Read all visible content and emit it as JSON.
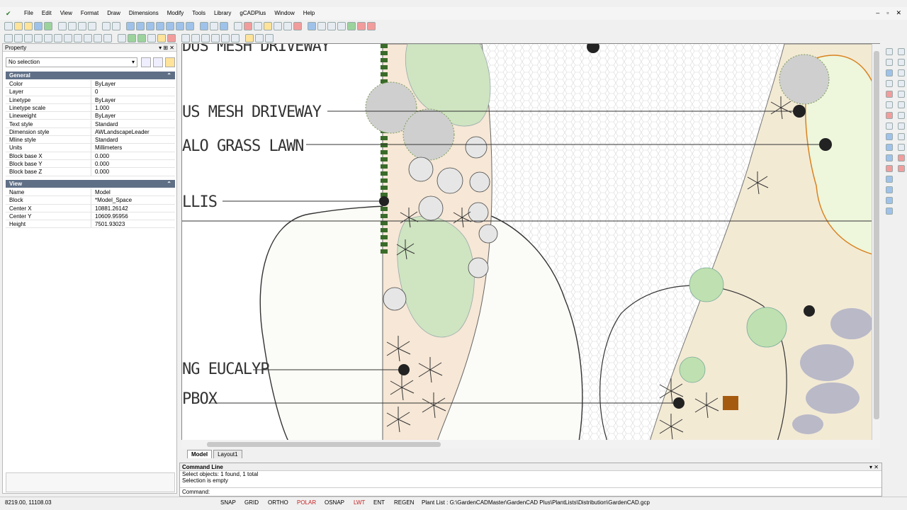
{
  "menu": [
    "File",
    "Edit",
    "View",
    "Format",
    "Draw",
    "Dimensions",
    "Modify",
    "Tools",
    "Library",
    "gCADPlus",
    "Window",
    "Help"
  ],
  "window_controls": [
    "–",
    "▫",
    "✕"
  ],
  "property_panel": {
    "title": "Property",
    "header_icons": [
      "▾",
      "⊞",
      "✕"
    ],
    "selection": "No selection",
    "general_title": "General",
    "general": [
      {
        "k": "Color",
        "v": "ByLayer"
      },
      {
        "k": "Layer",
        "v": "0"
      },
      {
        "k": "Linetype",
        "v": "ByLayer"
      },
      {
        "k": "Linetype scale",
        "v": "1.000"
      },
      {
        "k": "Lineweight",
        "v": "ByLayer"
      },
      {
        "k": "Text style",
        "v": "Standard"
      },
      {
        "k": "Dimension style",
        "v": "AWLandscapeLeader"
      },
      {
        "k": "Mline style",
        "v": "Standard"
      },
      {
        "k": "Units",
        "v": "Millimeters"
      },
      {
        "k": "Block base X",
        "v": "0.000"
      },
      {
        "k": "Block base Y",
        "v": "0.000"
      },
      {
        "k": "Block base Z",
        "v": "0.000"
      }
    ],
    "view_title": "View",
    "view": [
      {
        "k": "Name",
        "v": "Model"
      },
      {
        "k": "Block",
        "v": "*Model_Space"
      },
      {
        "k": "Center X",
        "v": "10881.26142"
      },
      {
        "k": "Center Y",
        "v": "10609.95956"
      },
      {
        "k": "Height",
        "v": "7501.93023"
      }
    ]
  },
  "drawing_labels": {
    "l1": "DUS MESH DRIVEWAY",
    "l2": "US MESH DRIVEWAY",
    "l3": "ALO GRASS LAWN",
    "l4": "LLIS",
    "l5": "NG EUCALYP",
    "l6": "PBOX"
  },
  "tabs": [
    "Model",
    "Layout1"
  ],
  "command": {
    "title": "Command Line",
    "lines": [
      "Select objects: 1 found,  1 total",
      "Selection is empty"
    ],
    "prompt": "Command:"
  },
  "status": {
    "coords": "8219.00,  11108.03",
    "buttons": [
      "SNAP",
      "GRID",
      "ORTHO",
      "POLAR",
      "OSNAP",
      "LWT",
      "ENT",
      "REGEN"
    ],
    "plant_list": "Plant List : G:\\GardenCADMaster\\GardenCAD Plus\\PlantLists\\Distribution\\GardenCAD.gcp"
  },
  "colors": {
    "section": "#5f6f86",
    "polar": "#c62020",
    "lwt": "#c62020",
    "paving": "#f6e7d6",
    "lawn": "#cfe4c1",
    "path": "#fdfdf5",
    "stone": "#b9b9c8"
  }
}
